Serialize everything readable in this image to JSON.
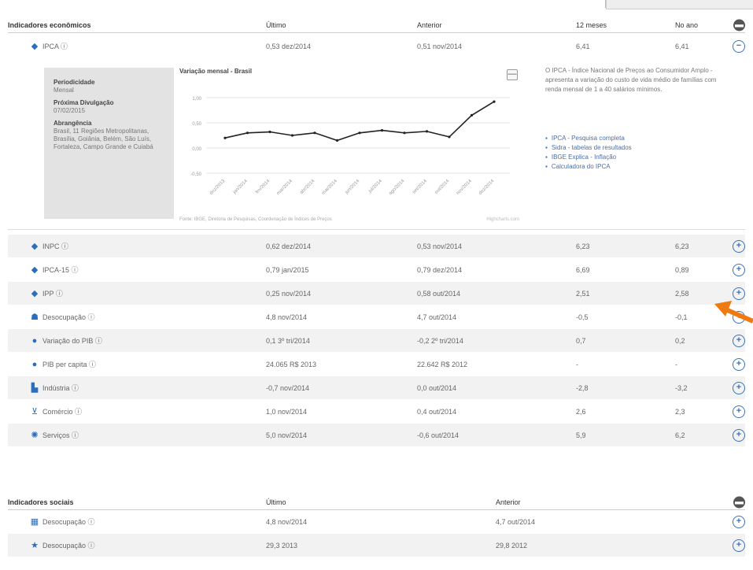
{
  "economic": {
    "header": {
      "name": "Indicadores econômicos",
      "last": "Último",
      "previous": "Anterior",
      "twelve": "12 meses",
      "year": "No ano"
    },
    "rows": [
      {
        "name": "IPCA ⓘ",
        "last": "0,53 dez/2014",
        "previous": "0,51 nov/2014",
        "twelve": "6,41",
        "year": "6,41",
        "icon": "calculator-icon"
      },
      {
        "name": "INPC ⓘ",
        "last": "0,62 dez/2014",
        "previous": "0,53 nov/2014",
        "twelve": "6,23",
        "year": "6,23",
        "icon": "calculator-icon"
      },
      {
        "name": "IPCA-15 ⓘ",
        "last": "0,79 jan/2015",
        "previous": "0,79 dez/2014",
        "twelve": "6,69",
        "year": "0,89",
        "icon": "calculator-icon"
      },
      {
        "name": "IPP ⓘ",
        "last": "0,25 nov/2014",
        "previous": "0,58 out/2014",
        "twelve": "2,51",
        "year": "2,58",
        "icon": "calculator-icon"
      },
      {
        "name": "Desocupação ⓘ",
        "last": "4,8 nov/2014",
        "previous": "4,7 out/2014",
        "twelve": "-0,5",
        "year": "-0,1",
        "icon": "people-icon"
      },
      {
        "name": "Variação do PIB ⓘ",
        "last": "0,1 3º tri/2014",
        "previous": "-0,2 2º tri/2014",
        "twelve": "0,7",
        "year": "0,2",
        "icon": "money-bag-icon"
      },
      {
        "name": "PIB per capita ⓘ",
        "last": "24.065 R$ 2013",
        "previous": "22.642 R$ 2012",
        "twelve": "-",
        "year": "-",
        "icon": "money-bag-icon"
      },
      {
        "name": "Indústria ⓘ",
        "last": "-0,7 nov/2014",
        "previous": "0,0 out/2014",
        "twelve": "-2,8",
        "year": "-3,2",
        "icon": "factory-icon"
      },
      {
        "name": "Comércio ⓘ",
        "last": "1,0 nov/2014",
        "previous": "0,4 out/2014",
        "twelve": "2,6",
        "year": "2,3",
        "icon": "cart-icon"
      },
      {
        "name": "Serviços ⓘ",
        "last": "5,0 nov/2014",
        "previous": "-0,6 out/2014",
        "twelve": "5,9",
        "year": "6,2",
        "icon": "gear-icon"
      }
    ]
  },
  "expanded": {
    "periodicity_label": "Periodicidade",
    "periodicity": "Mensal",
    "next_release_label": "Próxima Divulgação",
    "next_release": "07/02/2015",
    "coverage_label": "Abrangência",
    "coverage": "Brasil, 11 Regiões Metropolitanas, Brasília, Goiânia, Belém, São Luís, Fortaleza, Campo Grande e Cuiabá",
    "description": "O IPCA - Índice Nacional de Preços ao Consumidor Amplo - apresenta a variação do custo de vida médio de famílias com renda mensal de 1 a 40 salários mínimos.",
    "links": [
      "IPCA - Pesquisa completa",
      "Sidra - tabelas de resultados",
      "IBGE Explica - Inflação",
      "Calculadora do IPCA"
    ],
    "minus_symbol": "—",
    "chart_source": "Fonte: IBGE, Diretoria de Pesquisas, Coordenação de Índices de Preços",
    "chart_copyright": "Highcharts.com"
  },
  "chart_data": {
    "type": "line",
    "title": "Variação mensal - Brasil",
    "categories": [
      "dez/2013",
      "jan/2014",
      "fev/2014",
      "mar/2014",
      "abr/2014",
      "mai/2014",
      "jun/2014",
      "jul/2014",
      "ago/2014",
      "set/2014",
      "out/2014",
      "nov/2014",
      "dez/2014"
    ],
    "values": [
      0.2,
      0.3,
      0.32,
      0.25,
      0.3,
      0.15,
      0.3,
      0.35,
      0.3,
      0.33,
      0.22,
      0.65,
      0.92
    ],
    "yticks": [
      "1,00",
      "0,50",
      "0,00",
      "-0,50"
    ],
    "ylim": [
      -0.5,
      1.25
    ],
    "grid": true,
    "color": "#222222"
  },
  "social": {
    "header": {
      "name": "Indicadores sociais",
      "last": "Último",
      "previous": "Anterior"
    },
    "rows": [
      {
        "name": "Desocupação ⓘ",
        "last": "4,8 nov/2014",
        "previous": "4,7 out/2014",
        "icon": "people-icon"
      },
      {
        "name": "Desocupação ⓘ",
        "last": "29,3 2013",
        "previous": "29,8 2012",
        "icon": "star-icon"
      }
    ]
  },
  "buttons": {
    "expand": "+",
    "collapse": "−"
  }
}
